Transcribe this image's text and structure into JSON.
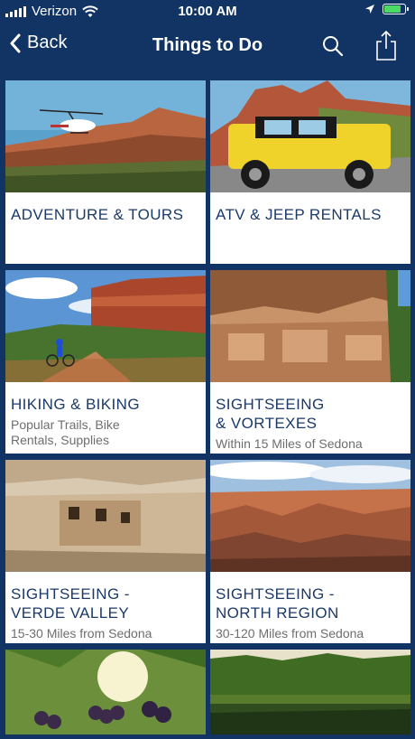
{
  "status": {
    "carrier": "Verizon",
    "time": "10:00 AM"
  },
  "nav": {
    "back_label": "Back",
    "title": "Things to Do"
  },
  "cards": [
    {
      "title": "ADVENTURE & TOURS",
      "subtitle": ""
    },
    {
      "title": "ATV & JEEP RENTALS",
      "subtitle": ""
    },
    {
      "title": "HIKING & BIKING",
      "subtitle": "Popular Trails, Bike\nRentals, Supplies"
    },
    {
      "title": "SIGHTSEEING\n& VORTEXES",
      "subtitle": "Within 15 Miles of Sedona"
    },
    {
      "title": "SIGHTSEEING -\nVERDE VALLEY",
      "subtitle": "15-30 Miles from Sedona"
    },
    {
      "title": "SIGHTSEEING -\nNORTH REGION",
      "subtitle": "30-120 Miles from Sedona"
    },
    {
      "title": "",
      "subtitle": ""
    },
    {
      "title": "",
      "subtitle": ""
    }
  ],
  "icons": {
    "wifi": "wifi-icon",
    "location": "location-arrow-icon",
    "battery": "battery-icon",
    "back": "chevron-left-icon",
    "search": "search-icon",
    "share": "share-icon"
  },
  "colors": {
    "nav_bg": "#123465",
    "card_title": "#1b3a69",
    "card_subtitle": "#6e6e6e",
    "battery": "#4cd964"
  }
}
